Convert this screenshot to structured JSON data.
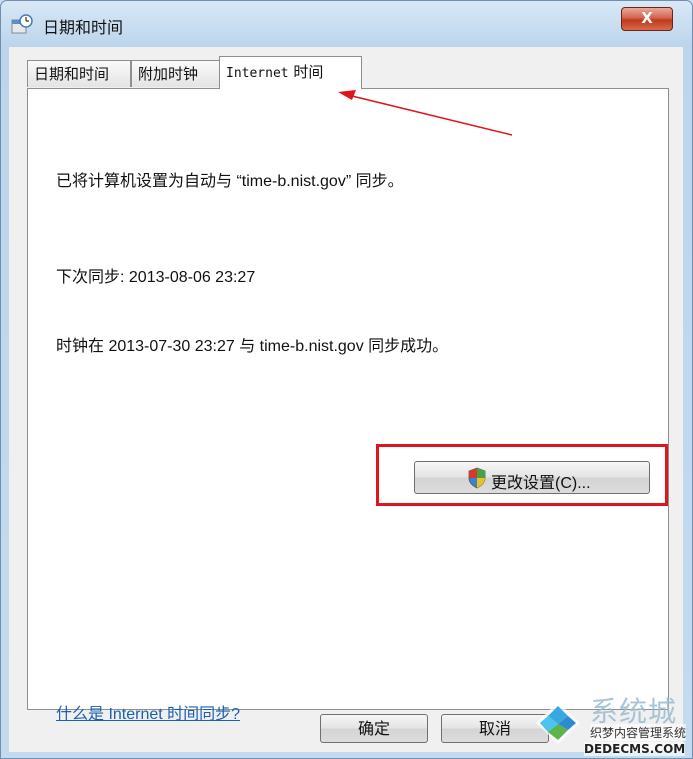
{
  "window": {
    "title": "日期和时间",
    "close_label": "X"
  },
  "tabs": [
    {
      "label": "日期和时间"
    },
    {
      "label": "附加时钟"
    },
    {
      "label_en": "Internet",
      "label_cn": " 时间"
    }
  ],
  "panel": {
    "sync_status": "已将计算机设置为自动与 “time-b.nist.gov” 同步。",
    "next_sync": "下次同步: 2013-08-06 23:27",
    "last_sync": "时钟在 2013-07-30 23:27 与 time-b.nist.gov 同步成功。",
    "change_settings_label": "更改设置(C)...",
    "help_link": "什么是 Internet 时间同步?"
  },
  "footer": {
    "ok_label": "确定",
    "cancel_label": "取消"
  },
  "watermark": {
    "brand": "系统城",
    "tagline": "织梦内容管理系统",
    "url": "DEDECMS.COM"
  },
  "colors": {
    "annotation_red": "#e0141b",
    "link_blue": "#1a5fb4"
  }
}
